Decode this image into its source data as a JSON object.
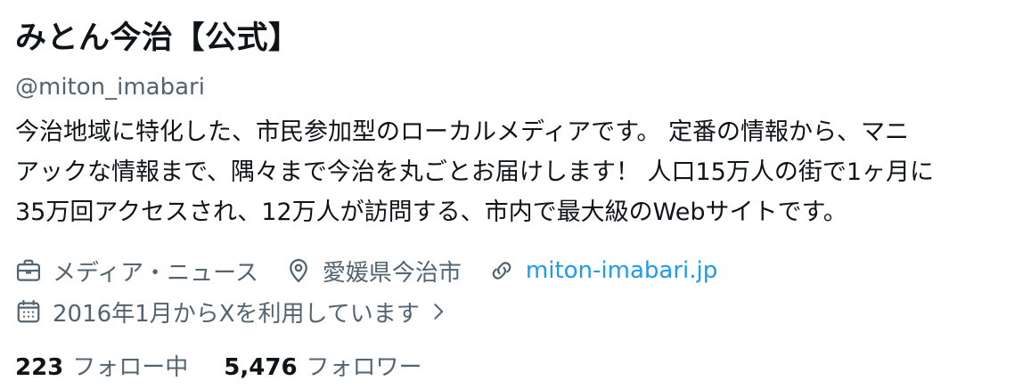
{
  "profile": {
    "display_name": "みとん今治【公式】",
    "handle": "@miton_imabari",
    "bio_lines": [
      "今治地域に特化した、市民参加型のローカルメディアです。 定番の情報から、マニ",
      "アックな情報まで、隅々まで今治を丸ごとお届けします！ 人口15万人の街で1ヶ月に",
      "35万回アクセスされ、12万人が訪問する、市内で最大級のWebサイトです。"
    ],
    "category": "メディア・ニュース",
    "location": "愛媛県今治市",
    "website": "miton-imabari.jp",
    "joined": "2016年1月からXを利用しています",
    "following_count": "223",
    "following_label": "フォロー中",
    "followers_count": "5,476",
    "followers_label": "フォロワー"
  },
  "icons": {
    "category": "briefcase-icon",
    "location": "location-pin-icon",
    "website": "link-icon",
    "joined": "calendar-icon",
    "joined_more": "chevron-right-icon"
  },
  "colors": {
    "text_primary": "#0f1419",
    "text_secondary": "#536471",
    "link": "#1d9bf0",
    "background": "#ffffff"
  }
}
